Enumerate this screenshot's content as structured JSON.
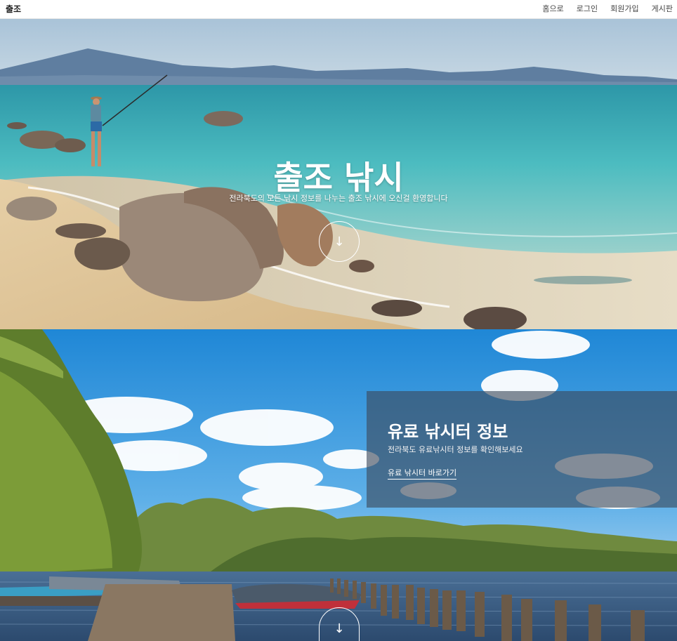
{
  "header": {
    "brand": "출조",
    "nav": [
      "홈으로",
      "로그인",
      "회원가입",
      "게시판"
    ]
  },
  "hero": {
    "title": "출조 낚시",
    "subtitle": "전라북도의 모든 낚시 정보를 나누는 출조 낚시에 오신걸 환영합니다",
    "scroll_icon": "arrow-down-icon"
  },
  "section2": {
    "title": "유료 낚시터 정보",
    "subtitle": "전라북도 유료낚시터 정보를 확인해보세요",
    "link": "유료 낚시터 바로가기",
    "scroll_icon": "arrow-down-icon"
  },
  "colors": {
    "sea": "#3fb4b8",
    "sky": "#1f8fd8",
    "panel": "#3c485a"
  }
}
